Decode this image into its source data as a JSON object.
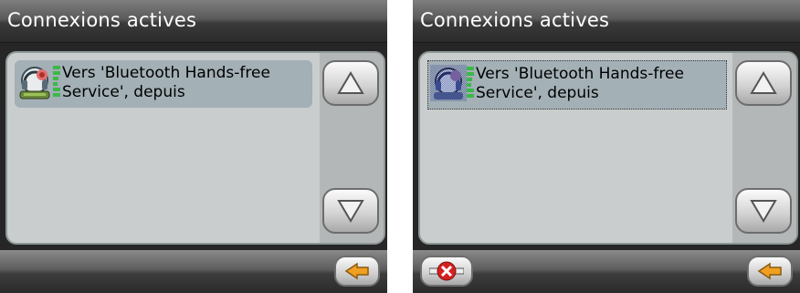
{
  "screens": [
    {
      "title": "Connexions actives",
      "connection": {
        "line1": "Vers 'Bluetooth Hands-free",
        "line2": "Service', depuis",
        "icon": "headset-icon",
        "state": "selected"
      },
      "buttons": [
        "scroll-up",
        "scroll-down",
        "back"
      ]
    },
    {
      "title": "Connexions actives",
      "connection": {
        "line1": "Vers 'Bluetooth Hands-free",
        "line2": "Service', depuis",
        "icon": "headset-icon",
        "state": "focused"
      },
      "buttons": [
        "disconnect",
        "scroll-up",
        "scroll-down",
        "back"
      ]
    }
  ],
  "colors": {
    "signal": "#3cb84a",
    "selection": "#a3b0b6",
    "panel": "#c9cdcd",
    "back_arrow": "#f0a020",
    "disconnect": "#d42020"
  }
}
